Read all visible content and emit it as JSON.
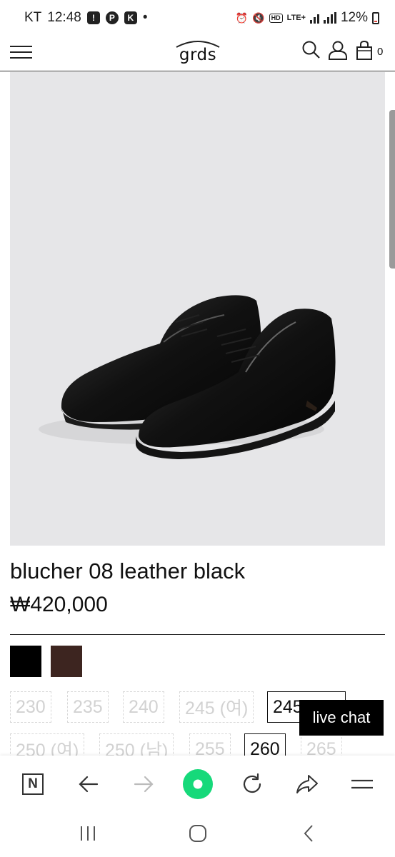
{
  "status_bar": {
    "carrier": "KT",
    "time": "12:48",
    "dot": "•",
    "network": "LTE+",
    "battery": "12%"
  },
  "header": {
    "logo": "grds",
    "cart_count": "0"
  },
  "product": {
    "name": "blucher 08 leather black",
    "price": "₩420,000",
    "colors": [
      {
        "name": "black",
        "hex": "#000000"
      },
      {
        "name": "brown",
        "hex": "#3d2520"
      }
    ],
    "sizes_row1": [
      "230",
      "235",
      "240",
      "245 (여)",
      "245"
    ],
    "sizes_row2": [
      "250 (여)",
      "250 (남)",
      "255",
      "260",
      "265"
    ]
  },
  "live_chat": {
    "label": "live chat"
  },
  "browser_toolbar": {
    "naver_label": "N"
  },
  "colors": {
    "accent_green": "#16d97a",
    "image_bg": "#e6e6e8"
  }
}
